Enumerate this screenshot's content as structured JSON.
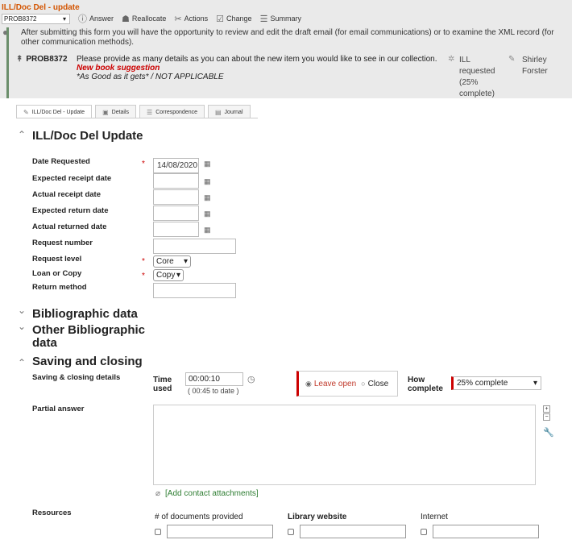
{
  "header": {
    "title": "ILL/Doc Del - update",
    "problem_select": "PROB8372",
    "toolbar": [
      {
        "label": "Answer",
        "icon": "info-circle-icon"
      },
      {
        "label": "Reallocate",
        "icon": "people-icon"
      },
      {
        "label": "Actions",
        "icon": "tools-icon"
      },
      {
        "label": "Change",
        "icon": "edit-icon"
      },
      {
        "label": "Summary",
        "icon": "list-icon"
      }
    ]
  },
  "info": {
    "text": "After submitting this form you will have the opportunity to review and edit the draft email (for email communications) or to examine the XML record (for other communication methods)."
  },
  "problem": {
    "id": "PROB8372",
    "description": "Please provide as many details as you can about the new item you would like to see in our collection.",
    "subtitle": "New book suggestion",
    "quote": "*As Good as it gets* / NOT APPLICABLE",
    "status": "ILL requested (25% complete)",
    "person": "Shirley Forster"
  },
  "tabs": [
    "ILL/Doc Del - Update",
    "Details",
    "Correspondence",
    "Journal"
  ],
  "sections": {
    "update_title": "ILL/Doc Del Update",
    "bibliographic": "Bibliographic data",
    "other_bibliographic": "Other Bibliographic data",
    "saving": "Saving and closing"
  },
  "form": {
    "date_requested_label": "Date Requested",
    "date_requested_value": "14/08/2020",
    "expected_receipt_label": "Expected receipt date",
    "actual_receipt_label": "Actual receipt date",
    "expected_return_label": "Expected return date",
    "actual_returned_label": "Actual returned date",
    "request_number_label": "Request number",
    "request_level_label": "Request level",
    "request_level_value": "Core",
    "loan_or_copy_label": "Loan or Copy",
    "loan_or_copy_value": "Copy",
    "return_method_label": "Return method",
    "required_mark": "*"
  },
  "saving": {
    "details_label": "Saving & closing details",
    "time_used_label": "Time used",
    "time_used_value": "00:00:10",
    "to_date": "( 00:45 to date )",
    "leave_open": "Leave open",
    "close": "Close",
    "how_complete_label": "How complete",
    "how_complete_value": "25% complete",
    "partial_answer_label": "Partial answer",
    "attachments_link": "[Add contact attachments]",
    "resources_label": "Resources",
    "res_docs": "# of documents provided",
    "res_library": "Library website",
    "res_internet": "Internet"
  }
}
